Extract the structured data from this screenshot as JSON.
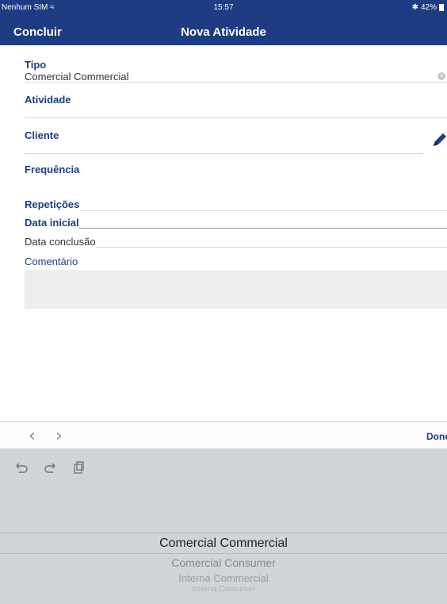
{
  "status_bar": {
    "carrier": "Nenhum SIM",
    "time": "15:57",
    "battery": "42%"
  },
  "nav": {
    "left_button": "Concluir",
    "title": "Nova Atividade"
  },
  "form": {
    "tipo": {
      "label": "Tipo",
      "value": "Comercial Commercial"
    },
    "atividade": {
      "label": "Atividade"
    },
    "cliente": {
      "label": "Cliente"
    },
    "frequencia": {
      "label": "Frequência"
    },
    "repeticoes": {
      "label": "Repetições"
    },
    "data_inicial": {
      "label": "Data inicial"
    },
    "data_conclusao": {
      "label": "Data conclusão"
    },
    "comentario": {
      "label": "Comentário"
    }
  },
  "keyboard_toolbar": {
    "prev_icon": "chevron-left",
    "next_icon": "chevron-right",
    "done": "Done"
  },
  "picker": {
    "selected": "Comercial Commercial",
    "options": [
      "Comercial Consumer",
      "Interna Commercial",
      "Interna Consumer"
    ]
  },
  "colors": {
    "brand": "#1d3c84",
    "picker_bg": "#d1d4d9",
    "comment_bg": "#eeeeee"
  }
}
